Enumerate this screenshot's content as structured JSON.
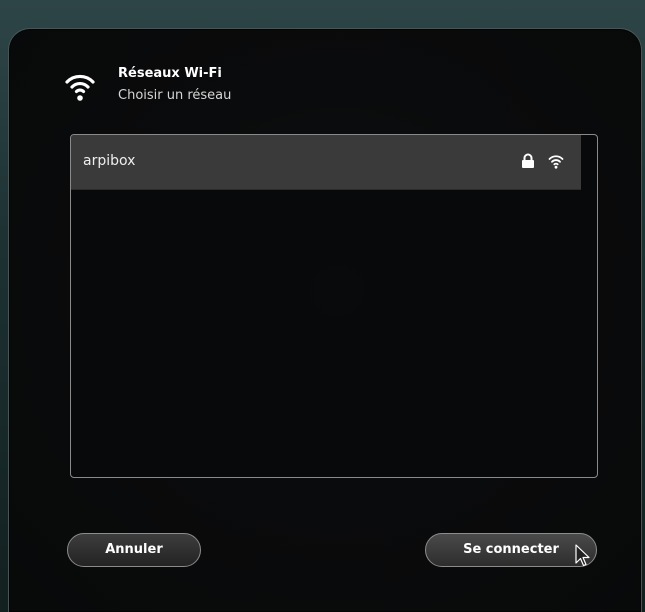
{
  "dialog": {
    "title": "Réseaux Wi-Fi",
    "subtitle": "Choisir un réseau",
    "header_icon": "wifi-icon"
  },
  "networks": [
    {
      "name": "arpibox",
      "secured": true,
      "icons": [
        "lock-icon",
        "wifi-signal-icon"
      ],
      "selected": true
    }
  ],
  "buttons": {
    "cancel_label": "Annuler",
    "connect_label": "Se connecter"
  },
  "colors": {
    "selected_row": "#3a3a3a",
    "dialog_bg": "#0a0b0c",
    "desktop_bg": "#1d3133"
  }
}
